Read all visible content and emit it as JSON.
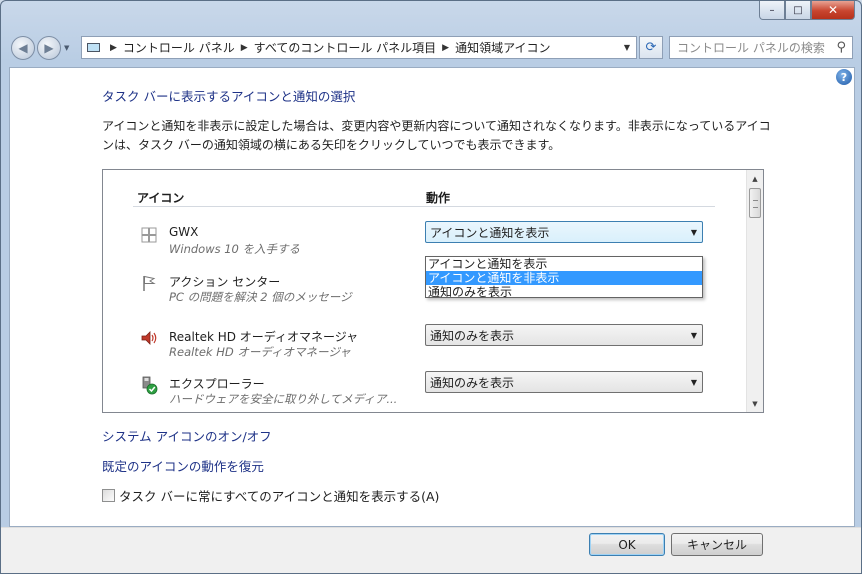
{
  "window": {
    "caption_buttons": {
      "minimize": "–",
      "maximize": "□",
      "close": "✕"
    }
  },
  "nav": {
    "breadcrumbs": [
      "コントロール パネル",
      "すべてのコントロール パネル項目",
      "通知領域アイコン"
    ],
    "search_placeholder": "コントロール パネルの検索",
    "icons": [
      "back-arrow-icon",
      "forward-arrow-icon",
      "computer-icon",
      "refresh-icon",
      "search-icon"
    ]
  },
  "content": {
    "heading": "タスク バーに表示するアイコンと通知の選択",
    "description": "アイコンと通知を非表示に設定した場合は、変更内容や更新内容について通知されなくなります。非表示になっているアイコンは、タスク バーの通知領域の横にある矢印をクリックしていつでも表示できます。",
    "table": {
      "col_icon": "アイコン",
      "col_action": "動作",
      "rows": [
        {
          "name": "GWX",
          "sub": "Windows 10 を入手する",
          "value": "アイコンと通知を表示",
          "icon": "windows-logo-icon"
        },
        {
          "name": "アクション センター",
          "sub": "PC の問題を解決 2 個のメッセージ",
          "value": "",
          "icon": "flag-icon"
        },
        {
          "name": "Realtek HD オーディオマネージャ",
          "sub": "Realtek HD オーディオマネージャ",
          "value": "通知のみを表示",
          "icon": "speaker-icon"
        },
        {
          "name": "エクスプローラー",
          "sub": "ハードウェアを安全に取り外してメディア...",
          "value": "通知のみを表示",
          "icon": "usb-safe-remove-icon"
        }
      ],
      "dropdown_options": [
        "アイコンと通知を表示",
        "アイコンと通知を非表示",
        "通知のみを表示"
      ],
      "dropdown_highlighted": "アイコンと通知を非表示"
    },
    "links": {
      "system_icons": "システム アイコンのオン/オフ",
      "restore_default": "既定のアイコンの動作を復元"
    },
    "checkbox_label": "タスク バーに常にすべてのアイコンと通知を表示する(A)",
    "checkbox_checked": false,
    "help": "?"
  },
  "footer": {
    "ok": "OK",
    "cancel": "キャンセル"
  },
  "colors": {
    "link": "#1e3287",
    "selection": "#3399ff",
    "title_bg": "#b9cde4"
  }
}
